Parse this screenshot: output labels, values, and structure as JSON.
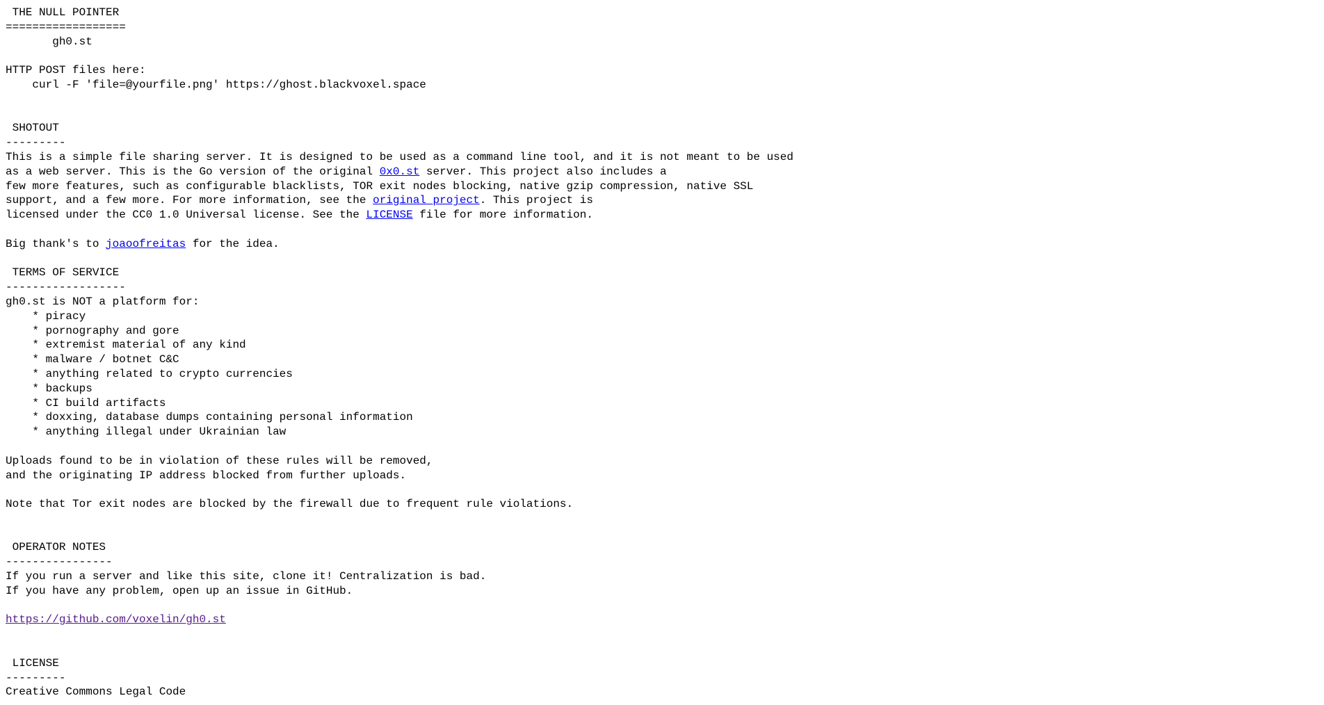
{
  "title_line": " THE NULL POINTER",
  "title_sep": "==================",
  "sitename": "       gh0.st",
  "post_header": "HTTP POST files here:",
  "post_cmd": "    curl -F 'file=@yourfile.png' https://ghost.blackvoxel.space",
  "shotout": {
    "heading": " SHOTOUT",
    "sep": "---------",
    "l1": "This is a simple file sharing server. It is designed to be used as a command line tool, and it is not meant to be used",
    "l2a": "as a web server. This is the Go version of the original ",
    "link_0x0": "0x0.st",
    "l2b": " server. This project also includes a",
    "l3": "few more features, such as configurable blacklists, TOR exit nodes blocking, native gzip compression, native SSL",
    "l4a": "support, and a few more. For more information, see the ",
    "link_orig": "original project",
    "l4b": ". This project is",
    "l5a": "licensed under the CC0 1.0 Universal license. See the ",
    "link_license": "LICENSE",
    "l5b": " file for more information.",
    "thanks_a": "Big thank's to ",
    "link_joao": "joaoofreitas",
    "thanks_b": " for the idea."
  },
  "tos": {
    "heading": " TERMS OF SERVICE",
    "sep": "------------------",
    "intro": "gh0.st is NOT a platform for:",
    "items": [
      "    * piracy",
      "    * pornography and gore",
      "    * extremist material of any kind",
      "    * malware / botnet C&C",
      "    * anything related to crypto currencies",
      "    * backups",
      "    * CI build artifacts",
      "    * doxxing, database dumps containing personal information",
      "    * anything illegal under Ukrainian law"
    ],
    "violation1": "Uploads found to be in violation of these rules will be removed,",
    "violation2": "and the originating IP address blocked from further uploads.",
    "tor": "Note that Tor exit nodes are blocked by the firewall due to frequent rule violations."
  },
  "operator": {
    "heading": " OPERATOR NOTES",
    "sep": "----------------",
    "l1": "If you run a server and like this site, clone it! Centralization is bad.",
    "l2": "If you have any problem, open up an issue in GitHub.",
    "repo_link": "https://github.com/voxelin/gh0.st"
  },
  "license": {
    "heading": " LICENSE",
    "sep": "---------",
    "l1": "Creative Commons Legal Code"
  }
}
